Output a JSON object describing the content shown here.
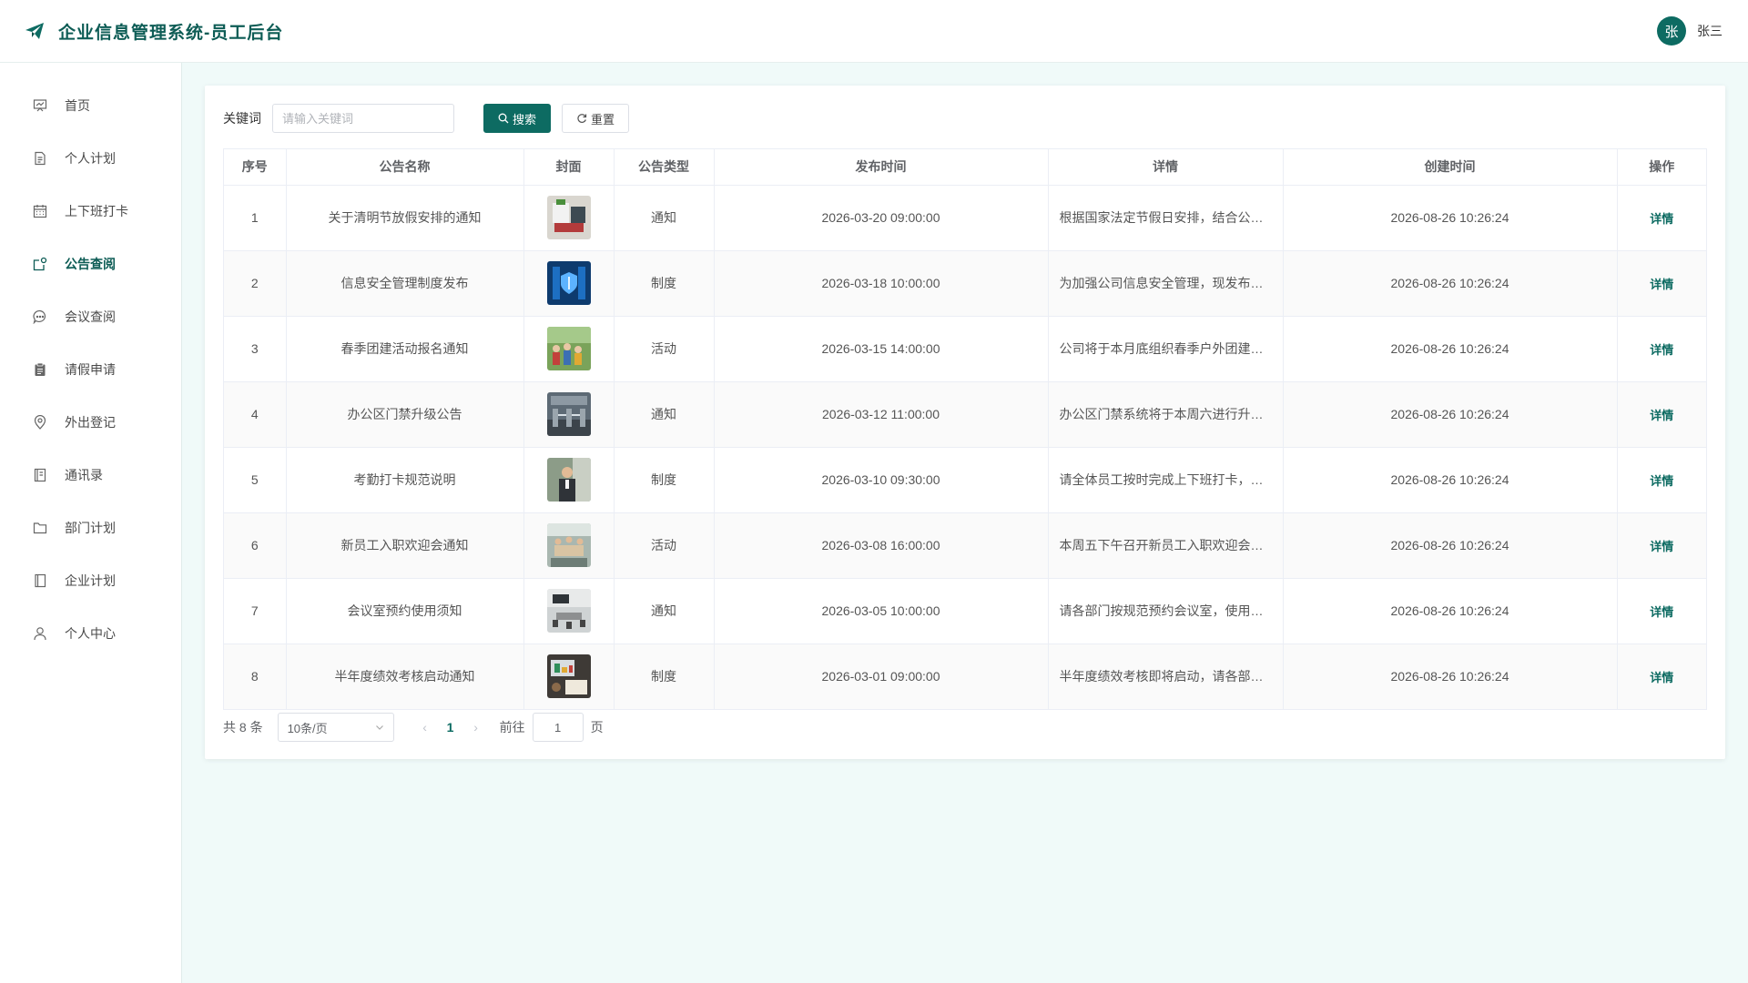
{
  "header": {
    "title": "企业信息管理系统-员工后台",
    "avatar_char": "张",
    "user_name": "张三",
    "accent": "#0d6b62"
  },
  "sidebar": {
    "items": [
      {
        "label": "首页",
        "icon": "presentation-icon"
      },
      {
        "label": "个人计划",
        "icon": "document-icon"
      },
      {
        "label": "上下班打卡",
        "icon": "calendar-icon"
      },
      {
        "label": "公告查阅",
        "icon": "notice-icon",
        "active": true
      },
      {
        "label": "会议查阅",
        "icon": "chat-icon"
      },
      {
        "label": "请假申请",
        "icon": "clipboard-icon"
      },
      {
        "label": "外出登记",
        "icon": "location-icon"
      },
      {
        "label": "通讯录",
        "icon": "address-book-icon"
      },
      {
        "label": "部门计划",
        "icon": "folder-icon"
      },
      {
        "label": "企业计划",
        "icon": "notebook-icon"
      },
      {
        "label": "个人中心",
        "icon": "user-icon"
      }
    ]
  },
  "search": {
    "label": "关键词",
    "placeholder": "请输入关键词",
    "search_label": "搜索",
    "reset_label": "重置"
  },
  "table": {
    "columns": [
      "序号",
      "公告名称",
      "封面",
      "公告类型",
      "发布时间",
      "详情",
      "创建时间",
      "操作"
    ],
    "action_label": "详情",
    "rows": [
      {
        "no": "1",
        "name": "关于清明节放假安排的通知",
        "type": "通知",
        "publish": "2026-03-20 09:00:00",
        "detail": "根据国家法定节假日安排，结合公司实际情况，现将清明节放假安排通知如下",
        "created": "2026-08-26 10:26:24",
        "cover": "office-photo"
      },
      {
        "no": "2",
        "name": "信息安全管理制度发布",
        "type": "制度",
        "publish": "2026-03-18 10:00:00",
        "detail": "为加强公司信息安全管理，现发布信息安全管理制度",
        "created": "2026-08-26 10:26:24",
        "cover": "security-photo"
      },
      {
        "no": "3",
        "name": "春季团建活动报名通知",
        "type": "活动",
        "publish": "2026-03-15 14:00:00",
        "detail": "公司将于本月底组织春季户外团建活动，欢迎报名",
        "created": "2026-08-26 10:26:24",
        "cover": "team-photo"
      },
      {
        "no": "4",
        "name": "办公区门禁升级公告",
        "type": "通知",
        "publish": "2026-03-12 11:00:00",
        "detail": "办公区门禁系统将于本周六进行升级，请提前知悉",
        "created": "2026-08-26 10:26:24",
        "cover": "gate-photo"
      },
      {
        "no": "5",
        "name": "考勤打卡规范说明",
        "type": "制度",
        "publish": "2026-03-10 09:30:00",
        "detail": "请全体员工按时完成上下班打卡，遵守考勤规范",
        "created": "2026-08-26 10:26:24",
        "cover": "person-photo"
      },
      {
        "no": "6",
        "name": "新员工入职欢迎会通知",
        "type": "活动",
        "publish": "2026-03-08 16:00:00",
        "detail": "本周五下午召开新员工入职欢迎会，请相关人员参加",
        "created": "2026-08-26 10:26:24",
        "cover": "meeting-photo"
      },
      {
        "no": "7",
        "name": "会议室预约使用须知",
        "type": "通知",
        "publish": "2026-03-05 10:00:00",
        "detail": "请各部门按规范预约会议室，使用后保持整洁",
        "created": "2026-08-26 10:26:24",
        "cover": "room-photo"
      },
      {
        "no": "8",
        "name": "半年度绩效考核启动通知",
        "type": "制度",
        "publish": "2026-03-01 09:00:00",
        "detail": "半年度绩效考核即将启动，请各部门做好准备工作",
        "created": "2026-08-26 10:26:24",
        "cover": "desk-photo"
      }
    ]
  },
  "pager": {
    "total_text": "共 8 条",
    "page_size": "10条/页",
    "current_page": "1",
    "goto_label": "前往",
    "goto_value": "1",
    "page_unit": "页"
  }
}
